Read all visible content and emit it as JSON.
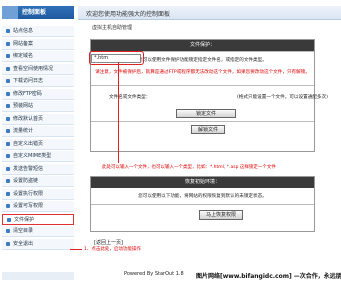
{
  "sidebar": {
    "header": "控制面板",
    "items": [
      {
        "label": "站点信息"
      },
      {
        "label": "网站备案"
      },
      {
        "label": "绑定域名"
      },
      {
        "label": "查看空间使用情况"
      },
      {
        "label": "下载访问日志"
      },
      {
        "label": "修改FTP密码"
      },
      {
        "label": "预装网站"
      },
      {
        "label": "修改默认首页"
      },
      {
        "label": "流量统计"
      },
      {
        "label": "自定义出错页"
      },
      {
        "label": "自定义MIME类型"
      },
      {
        "label": "发送告警短信"
      },
      {
        "label": "设置防盗链"
      },
      {
        "label": "设置执行权限"
      },
      {
        "label": "设置可写权限"
      },
      {
        "label": "文件保护",
        "active": true
      },
      {
        "label": "清空目录"
      },
      {
        "label": "安全退出"
      }
    ]
  },
  "topbar": {
    "title": "欢迎您使用功能强大的控制面板"
  },
  "main": {
    "breadcrumb": "虚拟主机自助管理",
    "protect_panel": {
      "header": "文件保护：",
      "desc": "您可以使用文件保护功能锁定指定文件名，或指定的文件类型。",
      "warning": "请注意，文件被保护后，就算是通过FTP或程序都无法改动这个文件，如果您要改动这个文件，只有解锁。",
      "file_label": "文件名或文件类型：",
      "file_value": "*.htm",
      "file_hint": "(格式只能设置一个文件，可以设置通配多次)",
      "lock_button": "锁定文件",
      "unlock_button": "解锁文件"
    },
    "middle_note": "此处可以输入一个文件，也可以输入一个类型，比如：*.html, *.asp 这样锁定一个文件",
    "restore_panel": {
      "header": "恢复初始环境：",
      "desc": "您可以使用以下功能，将网站的权限恢复到默认的未锁定状态。",
      "restore_button": "马上恢复权限"
    },
    "back_link": "[返回上一页]"
  },
  "notes": {
    "left_note": "1、点击此处，启动功能操作"
  },
  "footer": {
    "copyright": "Powered By StarOut 1.8",
    "watermark": "图片网络[www.bifangidc.com] —次合作，永远朋友"
  },
  "colors": {
    "accent": "#2f70b8",
    "annotation": "#dd2222"
  }
}
